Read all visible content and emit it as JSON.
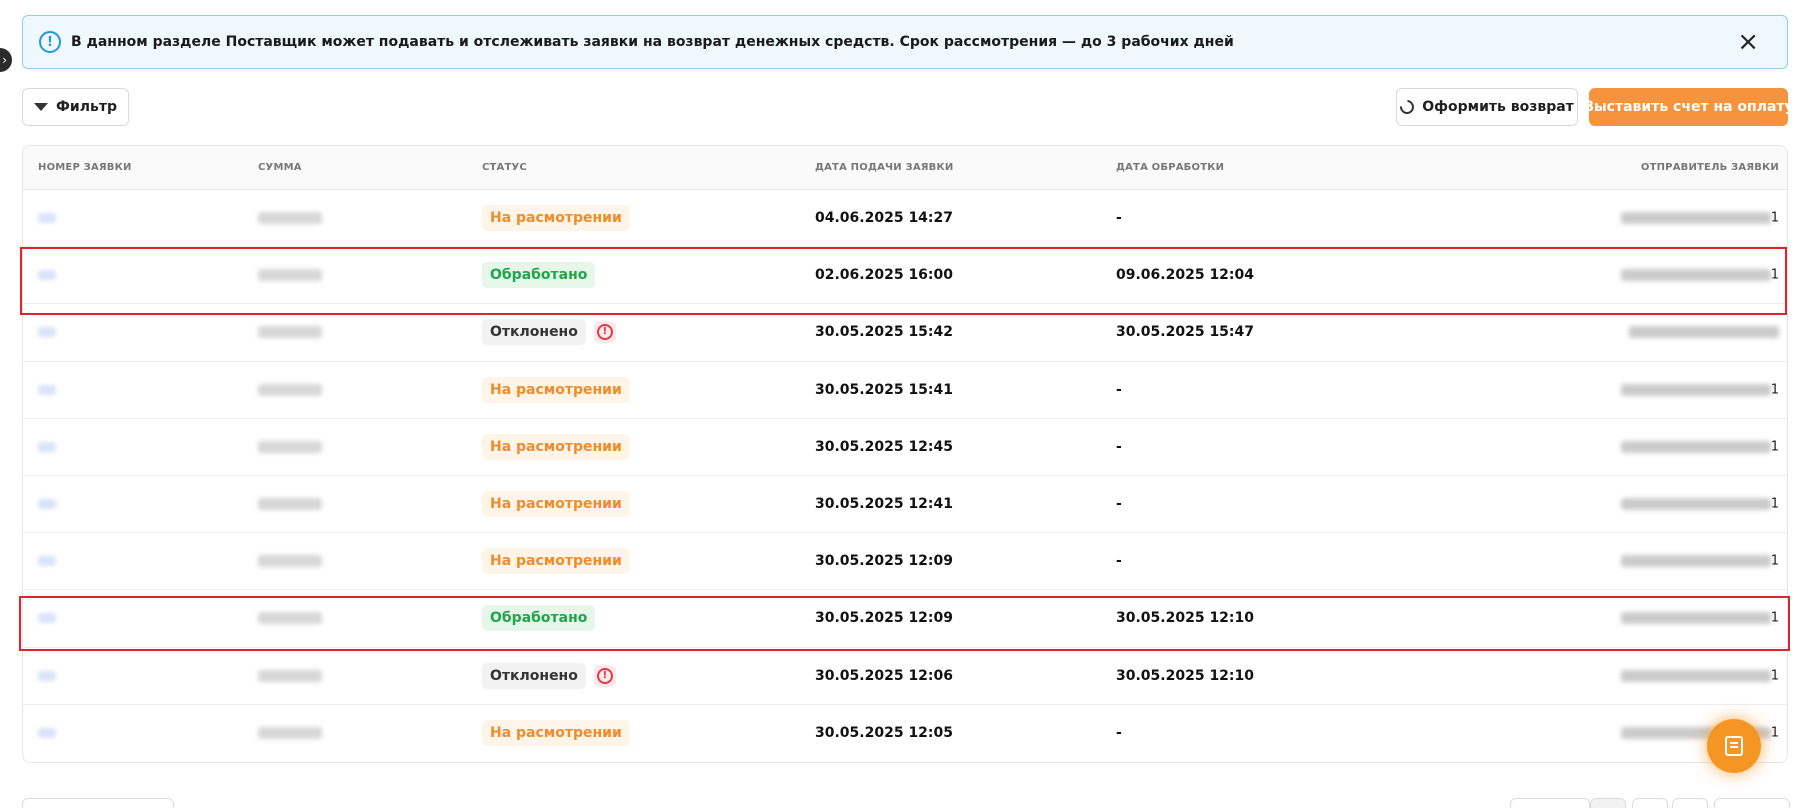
{
  "banner": {
    "text": "В данном разделе Поставщик может подавать и отслеживать заявки на возврат денежных средств. Срок рассмотрения — до 3 рабочих дней",
    "info_icon": "info-circle-icon",
    "close_icon": "close-icon"
  },
  "toolbar": {
    "filter_label": "Фильтр",
    "refund_label": "Оформить возврат",
    "invoice_label": "Выставить счет на оплату",
    "accent_color": "#f5943c"
  },
  "table": {
    "columns": [
      "НОМЕР ЗАЯВКИ",
      "СУММА",
      "СТАТУС",
      "ДАТА ПОДАЧИ ЗАЯВКИ",
      "ДАТА ОБРАБОТКИ",
      "ОТПРАВИТЕЛЬ ЗАЯВКИ"
    ],
    "rows": [
      {
        "status": "На расмотрении",
        "status_type": "review",
        "submitted": "04.06.2025 14:27",
        "processed": "-",
        "sender_tail": "1"
      },
      {
        "status": "Обработано",
        "status_type": "done",
        "submitted": "02.06.2025 16:00",
        "processed": "09.06.2025 12:04",
        "sender_tail": "1"
      },
      {
        "status": "Отклонено",
        "status_type": "rejected",
        "submitted": "30.05.2025 15:42",
        "processed": "30.05.2025 15:47",
        "sender_tail": ""
      },
      {
        "status": "На расмотрении",
        "status_type": "review",
        "submitted": "30.05.2025 15:41",
        "processed": "-",
        "sender_tail": "1"
      },
      {
        "status": "На расмотрении",
        "status_type": "review",
        "submitted": "30.05.2025 12:45",
        "processed": "-",
        "sender_tail": "1"
      },
      {
        "status": "На расмотрении",
        "status_type": "review",
        "submitted": "30.05.2025 12:41",
        "processed": "-",
        "sender_tail": "1"
      },
      {
        "status": "На расмотрении",
        "status_type": "review",
        "submitted": "30.05.2025 12:09",
        "processed": "-",
        "sender_tail": "1"
      },
      {
        "status": "Обработано",
        "status_type": "done",
        "submitted": "30.05.2025 12:09",
        "processed": "30.05.2025 12:10",
        "sender_tail": "1"
      },
      {
        "status": "Отклонено",
        "status_type": "rejected",
        "submitted": "30.05.2025 12:06",
        "processed": "30.05.2025 12:10",
        "sender_tail": "1"
      },
      {
        "status": "На расмотрении",
        "status_type": "review",
        "submitted": "30.05.2025 12:05",
        "processed": "-",
        "sender_tail": "1"
      }
    ]
  }
}
